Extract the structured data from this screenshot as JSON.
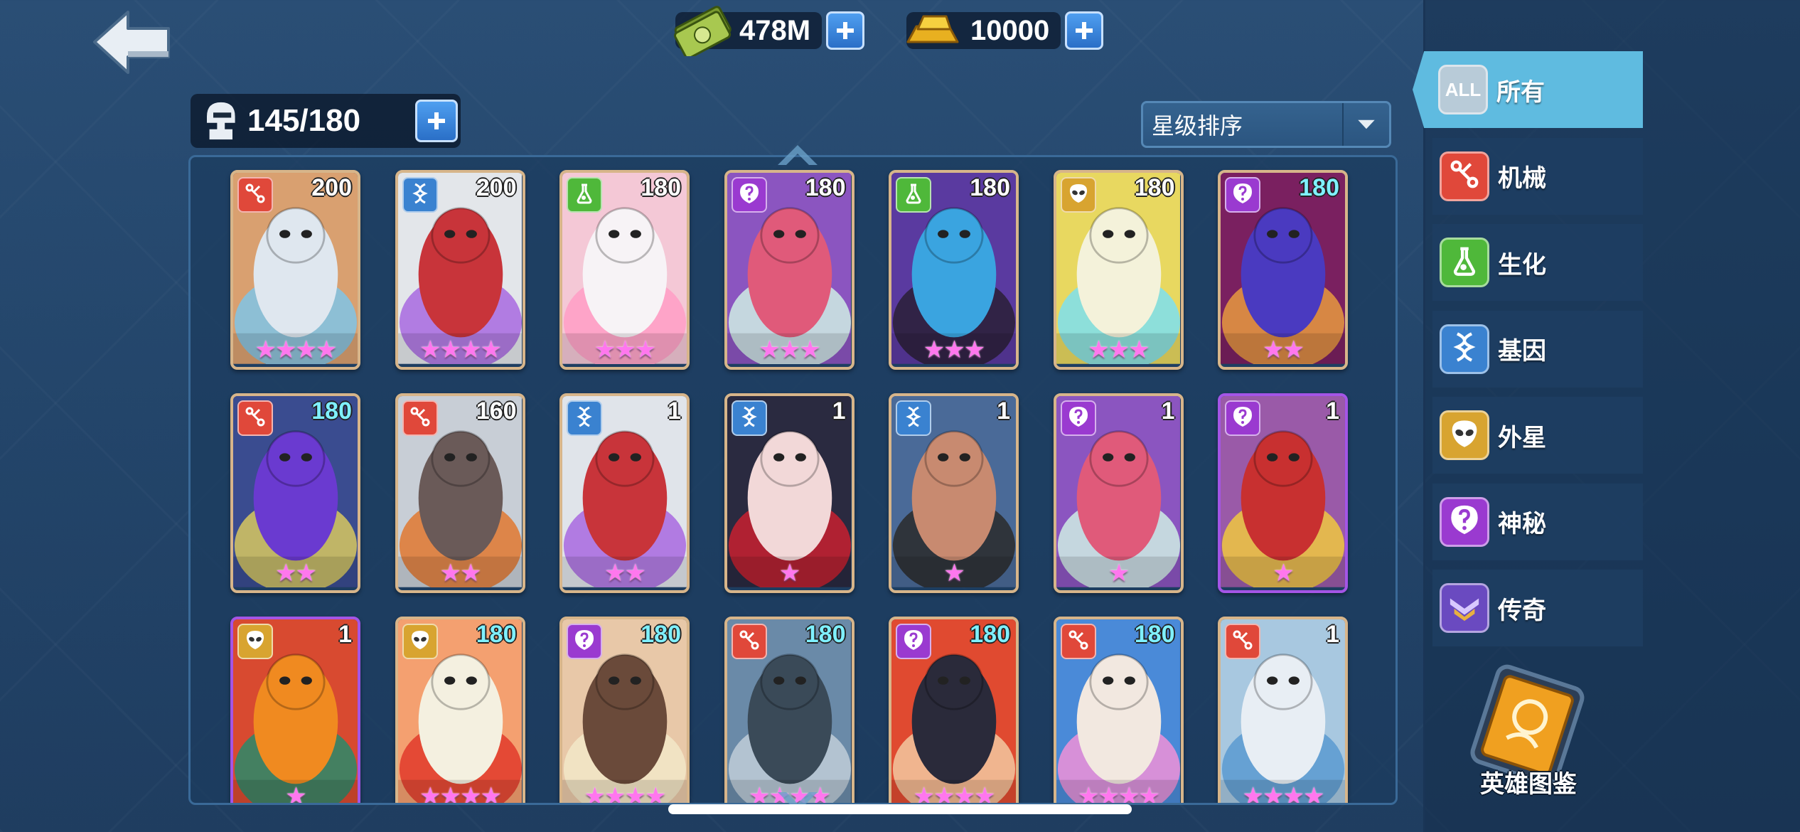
{
  "top_bar": {
    "back_icon": "back-arrow-icon",
    "money": {
      "icon": "cash-icon",
      "value": "478M"
    },
    "gold": {
      "icon": "gold-bar-icon",
      "value": "10000"
    }
  },
  "hero_capacity": {
    "icon": "helmet-icon",
    "value": "145/180"
  },
  "sort": {
    "label": "星级排序",
    "icon": "caret-down-icon"
  },
  "cards": [
    {
      "cls": "mech",
      "level": "200",
      "stars": "★★★★",
      "bg": "#d9a070",
      "fig": "#dfe7ef",
      "acc": "#7fc4e6",
      "teal": false,
      "purple": false
    },
    {
      "cls": "gene",
      "level": "200",
      "stars": "★★★★",
      "bg": "#e3e6ea",
      "fig": "#c8343a",
      "acc": "#a869e0",
      "teal": false,
      "purple": false
    },
    {
      "cls": "bio",
      "level": "180",
      "stars": "★★★",
      "bg": "#f4c8d6",
      "fig": "#f7f3f6",
      "acc": "#ff9ec6",
      "teal": false,
      "purple": false
    },
    {
      "cls": "myst",
      "level": "180",
      "stars": "★★★",
      "bg": "#8b55c0",
      "fig": "#e05a7a",
      "acc": "#cfeee4",
      "teal": false,
      "purple": false
    },
    {
      "cls": "bio",
      "level": "180",
      "stars": "★★★",
      "bg": "#5a3aa0",
      "fig": "#3aa4e0",
      "acc": "#2a2036",
      "teal": false,
      "purple": false
    },
    {
      "cls": "alien",
      "level": "180",
      "stars": "★★★",
      "bg": "#e8d860",
      "fig": "#f4f2da",
      "acc": "#7ce0f0",
      "teal": false,
      "purple": false
    },
    {
      "cls": "myst",
      "level": "180",
      "stars": "★★",
      "bg": "#7a2060",
      "fig": "#4a3ac0",
      "acc": "#e89a40",
      "teal": true,
      "purple": false
    },
    {
      "cls": "mech",
      "level": "180",
      "stars": "★★",
      "bg": "#3a4c90",
      "fig": "#6a3ad0",
      "acc": "#d8c860",
      "teal": true,
      "purple": false
    },
    {
      "cls": "mech",
      "level": "160",
      "stars": "★★",
      "bg": "#c8ced6",
      "fig": "#6a5a58",
      "acc": "#e07830",
      "teal": false,
      "purple": false
    },
    {
      "cls": "gene",
      "level": "1",
      "stars": "★★",
      "bg": "#e0e4ea",
      "fig": "#c8343a",
      "acc": "#a869e0",
      "teal": false,
      "purple": false
    },
    {
      "cls": "gene",
      "level": "1",
      "stars": "★",
      "bg": "#2a2a40",
      "fig": "#f2d8d8",
      "acc": "#c82030",
      "teal": false,
      "purple": false
    },
    {
      "cls": "gene",
      "level": "1",
      "stars": "★",
      "bg": "#4a6a98",
      "fig": "#c88a70",
      "acc": "#2a2a2a",
      "teal": false,
      "purple": false
    },
    {
      "cls": "myst",
      "level": "1",
      "stars": "★",
      "bg": "#8b55c0",
      "fig": "#e05a7a",
      "acc": "#cfeee4",
      "teal": false,
      "purple": false
    },
    {
      "cls": "myst",
      "level": "1",
      "stars": "★",
      "bg": "#9a5aa8",
      "fig": "#c83030",
      "acc": "#f0c840",
      "teal": false,
      "purple": true
    },
    {
      "cls": "alien",
      "level": "1",
      "stars": "★",
      "bg": "#d84a30",
      "fig": "#f08a20",
      "acc": "#2a8a6a",
      "teal": false,
      "purple": true
    },
    {
      "cls": "alien",
      "level": "180",
      "stars": "★★★★",
      "bg": "#f4a070",
      "fig": "#f4f0e0",
      "acc": "#e03a2a",
      "teal": true,
      "purple": false
    },
    {
      "cls": "myst",
      "level": "180",
      "stars": "★★★★",
      "bg": "#e8c8a8",
      "fig": "#6a4a3a",
      "acc": "#f2e8c8",
      "teal": true,
      "purple": false
    },
    {
      "cls": "mech",
      "level": "180",
      "stars": "★★★★",
      "bg": "#6a8aa8",
      "fig": "#3a4a58",
      "acc": "#c0ccd8",
      "teal": true,
      "purple": false
    },
    {
      "cls": "myst",
      "level": "180",
      "stars": "★★★★",
      "bg": "#e04a30",
      "fig": "#2a2a3a",
      "acc": "#f2c8a0",
      "teal": true,
      "purple": false
    },
    {
      "cls": "mech",
      "level": "180",
      "stars": "★★★★",
      "bg": "#4a8ad8",
      "fig": "#f2e8e0",
      "acc": "#f090d8",
      "teal": true,
      "purple": false
    },
    {
      "cls": "mech",
      "level": "1",
      "stars": "★★★★",
      "bg": "#a8c8e0",
      "fig": "#e8eef4",
      "acc": "#5a9ad0",
      "teal": false,
      "purple": false
    }
  ],
  "filters": [
    {
      "id": "all",
      "label": "所有",
      "icon": "all-icon",
      "badge_text": "ALL",
      "color": "#b8cbd8",
      "active": true
    },
    {
      "id": "mech",
      "label": "机械",
      "icon": "mech-icon",
      "color": "#e0483a",
      "active": false
    },
    {
      "id": "bio",
      "label": "生化",
      "icon": "bio-flask-icon",
      "color": "#4fb83a",
      "active": false
    },
    {
      "id": "gene",
      "label": "基因",
      "icon": "dna-icon",
      "color": "#3a82d0",
      "active": false
    },
    {
      "id": "alien",
      "label": "外星",
      "icon": "alien-icon",
      "color": "#d8a430",
      "active": false
    },
    {
      "id": "myst",
      "label": "神秘",
      "icon": "mystery-icon",
      "color": "#9a3ad0",
      "active": false
    },
    {
      "id": "legend",
      "label": "传奇",
      "icon": "legend-wings-icon",
      "color": "#6a4ac0",
      "active": false
    }
  ],
  "codex": {
    "label": "英雄图鉴",
    "icon": "hero-codex-icon"
  },
  "class_colors": {
    "mech": "#e0483a",
    "bio": "#4fb83a",
    "gene": "#3a82d0",
    "alien": "#d8a430",
    "myst": "#9a3ad0"
  }
}
